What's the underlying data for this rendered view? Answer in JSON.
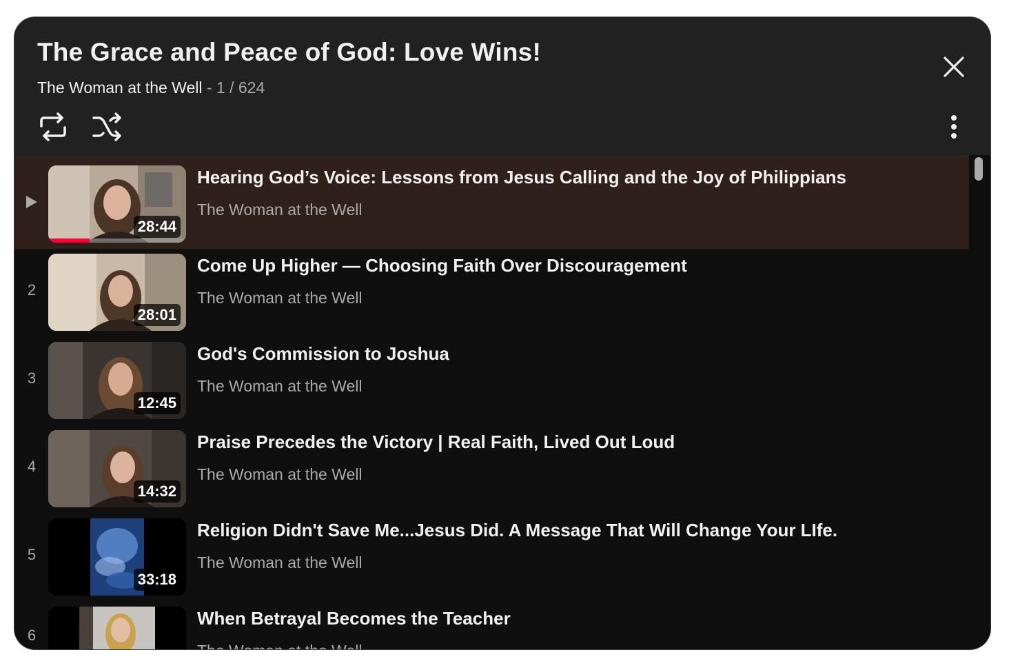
{
  "playlist": {
    "title": "The Grace and Peace of God: Love Wins!",
    "channel": "The Woman at the Well",
    "position": "- 1 / 624"
  },
  "icons": {
    "close": "close-icon",
    "loop": "loop-icon",
    "shuffle": "shuffle-icon",
    "more": "more-vert-icon",
    "now_playing": "play-triangle-icon"
  },
  "colors": {
    "background": "#0f0f0f",
    "header": "#212121",
    "active_row": "#2f201b",
    "progress": "#ff0033",
    "text_primary": "#f1f1f1",
    "text_secondary": "#aaaaaa"
  },
  "videos": [
    {
      "index": "▶",
      "title": "Hearing God’s Voice: Lessons from Jesus Calling and the Joy of Philippians",
      "channel": "The Woman at the Well",
      "duration": "28:44",
      "active": true,
      "watched_fraction": 0.3
    },
    {
      "index": "2",
      "title": "Come Up Higher — Choosing Faith Over Discouragement",
      "channel": "The Woman at the Well",
      "duration": "28:01",
      "active": false
    },
    {
      "index": "3",
      "title": "God's Commission to Joshua",
      "channel": "The Woman at the Well",
      "duration": "12:45",
      "active": false
    },
    {
      "index": "4",
      "title": "Praise Precedes the Victory | Real Faith, Lived Out Loud",
      "channel": "The Woman at the Well",
      "duration": "14:32",
      "active": false
    },
    {
      "index": "5",
      "title": "Religion Didn't Save Me...Jesus Did. A Message That Will Change Your LIfe.",
      "channel": "The Woman at the Well",
      "duration": "33:18",
      "active": false
    },
    {
      "index": "6",
      "title": "When Betrayal Becomes the Teacher",
      "channel": "The Woman at the Well",
      "duration": "",
      "active": false
    }
  ]
}
